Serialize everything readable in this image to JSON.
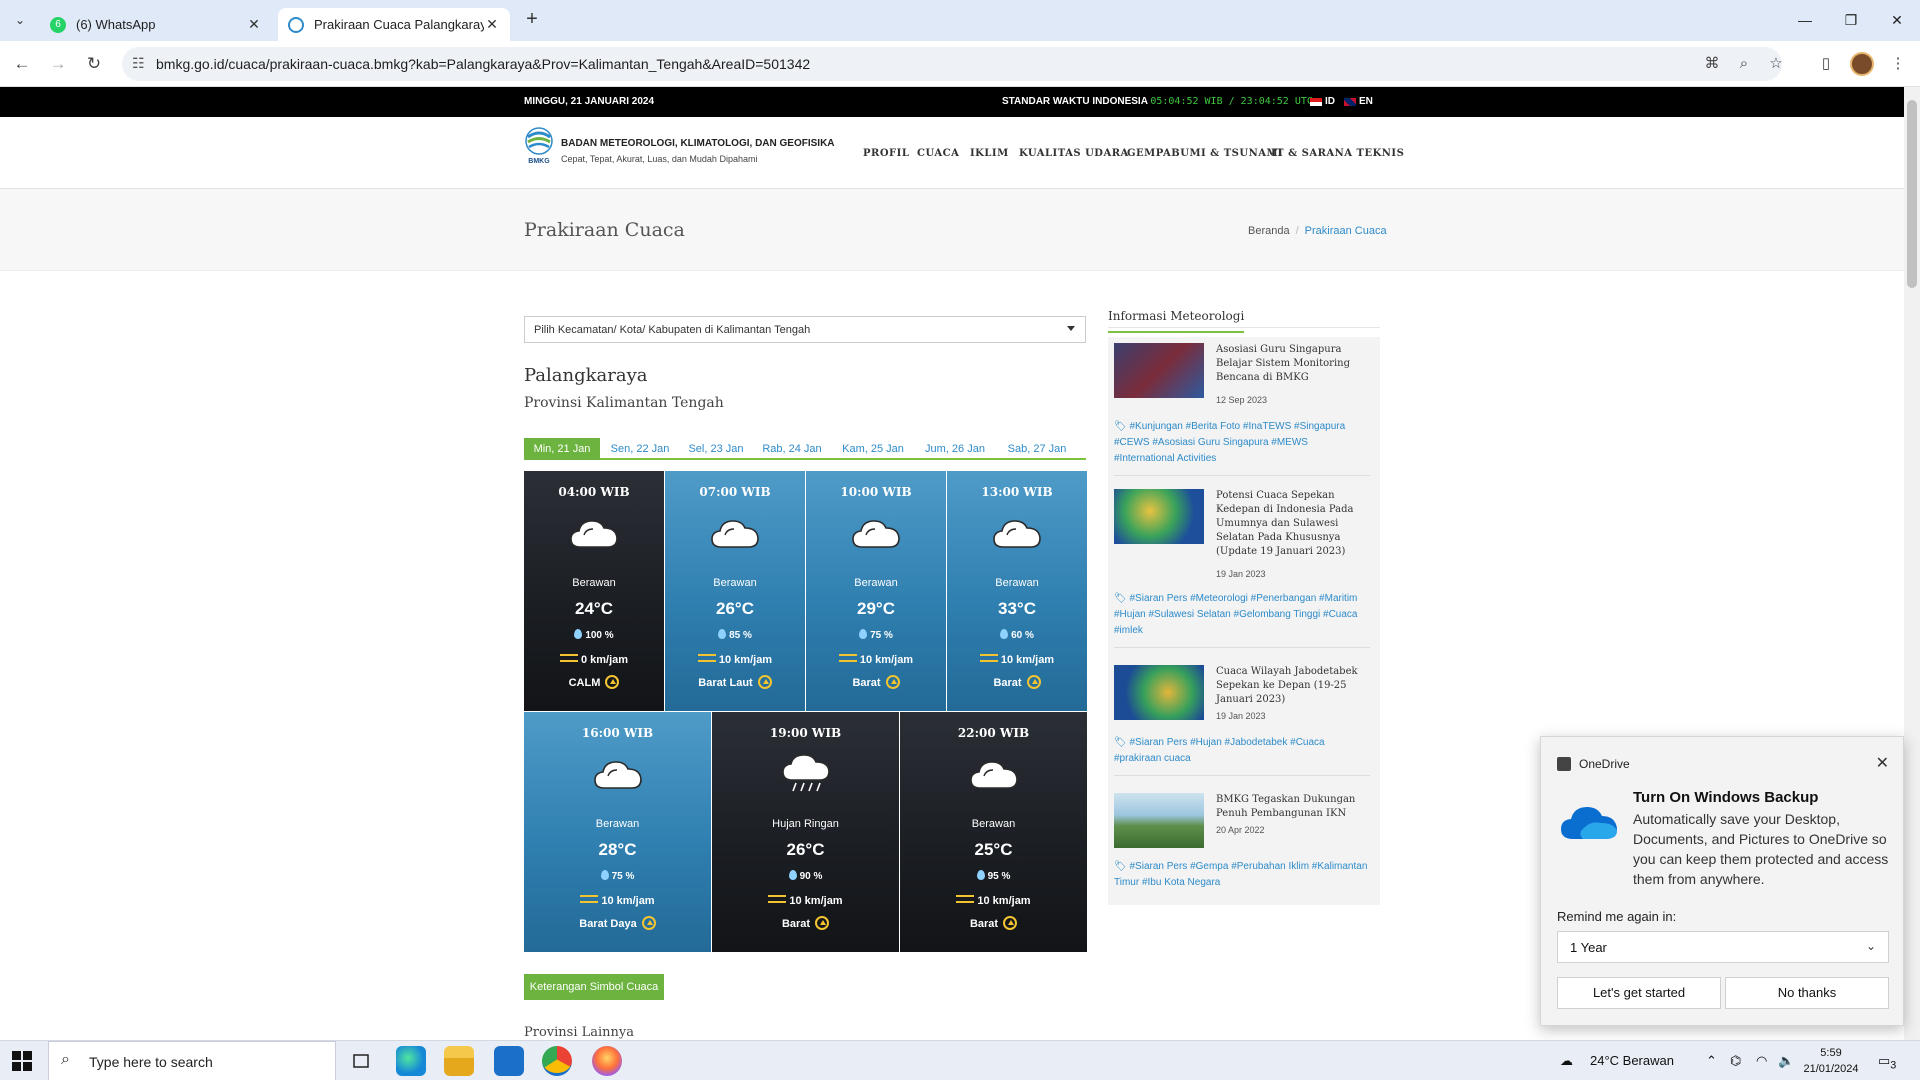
{
  "browser": {
    "tabs": [
      {
        "title": "(6) WhatsApp",
        "badge": "6"
      },
      {
        "title": "Prakiraan Cuaca Palangkaraya"
      }
    ],
    "url": "bmkg.go.id/cuaca/prakiraan-cuaca.bmkg?kab=Palangkaraya&Prov=Kalimantan_Tengah&AreaID=501342"
  },
  "topbar": {
    "date": "MINGGU, 21 JANUARI 2024",
    "std_label": "STANDAR WAKTU INDONESIA",
    "clock": "05:04:52 WIB / 23:04:52 UTC",
    "lang_id": "ID",
    "lang_en": "EN"
  },
  "header": {
    "logo_text": "BMKG",
    "brand": "BADAN METEOROLOGI, KLIMATOLOGI, DAN GEOFISIKA",
    "tagline": "Cepat, Tepat, Akurat, Luas, dan Mudah Dipahami",
    "menu": [
      "PROFIL",
      "CUACA",
      "IKLIM",
      "KUALITAS UDARA",
      "GEMPABUMI & TSUNAMI",
      "IT & SARANA TEKNIS"
    ]
  },
  "titlebar": {
    "title": "Prakiraan Cuaca",
    "breadcrumb_home": "Beranda",
    "breadcrumb_current": "Prakiraan Cuaca"
  },
  "main": {
    "select_label": "Pilih Kecamatan/ Kota/ Kabupaten di Kalimantan Tengah",
    "city": "Palangkaraya",
    "province": "Provinsi Kalimantan Tengah",
    "day_tabs": [
      "Min, 21 Jan",
      "Sen, 22 Jan",
      "Sel, 23 Jan",
      "Rab, 24 Jan",
      "Kam, 25 Jan",
      "Jum, 26 Jan",
      "Sab, 27 Jan"
    ],
    "forecasts": [
      {
        "time": "04:00 WIB",
        "weather": "Berawan",
        "temp": "24°C",
        "humidity": "100 %",
        "wind": "0 km/jam",
        "direction": "CALM",
        "icon": "cloud-icon"
      },
      {
        "time": "07:00 WIB",
        "weather": "Berawan",
        "temp": "26°C",
        "humidity": "85 %",
        "wind": "10 km/jam",
        "direction": "Barat Laut",
        "icon": "cloud-icon"
      },
      {
        "time": "10:00 WIB",
        "weather": "Berawan",
        "temp": "29°C",
        "humidity": "75 %",
        "wind": "10 km/jam",
        "direction": "Barat",
        "icon": "cloud-icon"
      },
      {
        "time": "13:00 WIB",
        "weather": "Berawan",
        "temp": "33°C",
        "humidity": "60 %",
        "wind": "10 km/jam",
        "direction": "Barat",
        "icon": "cloud-icon"
      },
      {
        "time": "16:00 WIB",
        "weather": "Berawan",
        "temp": "28°C",
        "humidity": "75 %",
        "wind": "10 km/jam",
        "direction": "Barat Daya",
        "icon": "cloud-icon"
      },
      {
        "time": "19:00 WIB",
        "weather": "Hujan Ringan",
        "temp": "26°C",
        "humidity": "90 %",
        "wind": "10 km/jam",
        "direction": "Barat",
        "icon": "rain-cloud-icon"
      },
      {
        "time": "22:00 WIB",
        "weather": "Berawan",
        "temp": "25°C",
        "humidity": "95 %",
        "wind": "10 km/jam",
        "direction": "Barat",
        "icon": "cloud-icon"
      }
    ],
    "legend_button": "Keterangan Simbol Cuaca",
    "other_provinces": "Provinsi Lainnya"
  },
  "sidebar": {
    "heading": "Informasi Meteorologi",
    "news": [
      {
        "title": "Asosiasi Guru Singapura Belajar Sistem Monitoring Bencana di BMKG",
        "date": "12 Sep 2023",
        "tags": "#Kunjungan #Berita Foto #InaTEWS #Singapura #CEWS #Asosiasi Guru Singapura #MEWS #International Activities"
      },
      {
        "title": "Potensi Cuaca Sepekan Kedepan di Indonesia Pada Umumnya dan Sulawesi Selatan Pada Khususnya (Update 19 Januari 2023)",
        "date": "19 Jan 2023",
        "tags": "#Siaran Pers #Meteorologi #Penerbangan #Maritim #Hujan #Sulawesi Selatan #Gelombang Tinggi #Cuaca #imlek"
      },
      {
        "title": "Cuaca Wilayah Jabodetabek Sepekan ke Depan (19-25 Januari 2023)",
        "date": "19 Jan 2023",
        "tags": "#Siaran Pers #Hujan #Jabodetabek #Cuaca #prakiraan cuaca"
      },
      {
        "title": "BMKG Tegaskan Dukungan Penuh Pembangunan IKN",
        "date": "20 Apr 2022",
        "tags": "#Siaran Pers #Gempa #Perubahan Iklim #Kalimantan Timur #Ibu Kota Negara"
      }
    ]
  },
  "toast": {
    "app": "OneDrive",
    "title": "Turn On Windows Backup",
    "body": "Automatically save your Desktop, Documents, and Pictures to OneDrive so you can keep them protected and access them from anywhere.",
    "remind_label": "Remind me again in:",
    "remind_value": "1 Year",
    "primary": "Let's get started",
    "secondary": "No thanks"
  },
  "taskbar": {
    "search_placeholder": "Type here to search",
    "weather": "24°C  Berawan",
    "time": "5:59",
    "date": "21/01/2024",
    "notifications": "3"
  }
}
